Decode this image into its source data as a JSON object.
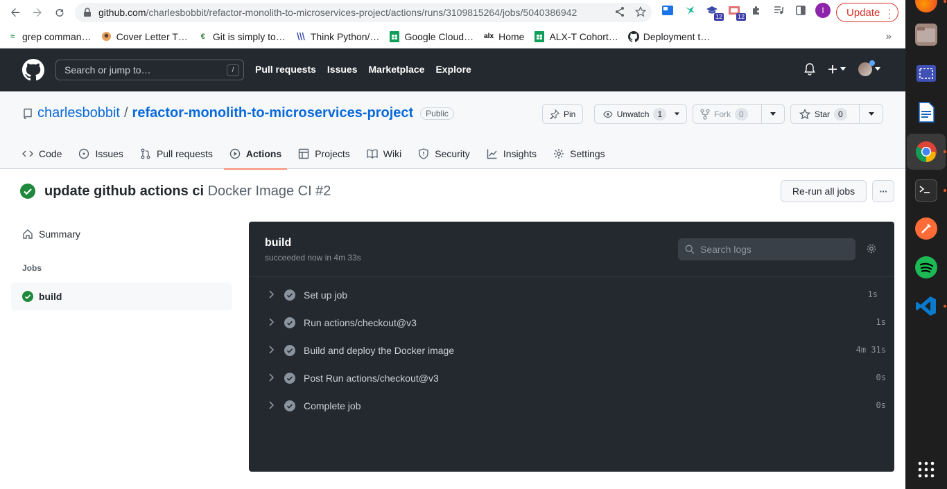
{
  "browser": {
    "url_domain": "github.com",
    "url_path": "/charlesbobbit/refactor-monolith-to-microservices-project/actions/runs/3109815264/jobs/5040386942",
    "update_label": "Update",
    "profile_initial": "I",
    "ext_badge": "12",
    "ext_badge2": "12",
    "bookmarks": [
      {
        "label": "grep comman…",
        "icon": "grep-icon"
      },
      {
        "label": "Cover Letter T…",
        "icon": "cover-letter-icon"
      },
      {
        "label": "Git is simply to…",
        "icon": "git-icon"
      },
      {
        "label": "Think Python/…",
        "icon": "python-icon"
      },
      {
        "label": "Google Cloud…",
        "icon": "sheets-icon"
      },
      {
        "label": "Home",
        "icon": "alx-icon"
      },
      {
        "label": "ALX-T Cohort…",
        "icon": "sheets-icon"
      },
      {
        "label": "Deployment t…",
        "icon": "github-icon"
      }
    ],
    "bookmarks_more": "»",
    "alx_text": "alx"
  },
  "github": {
    "search_placeholder": "Search or jump to…",
    "search_key": "/",
    "nav": [
      "Pull requests",
      "Issues",
      "Marketplace",
      "Explore"
    ]
  },
  "repo": {
    "owner": "charlesbobbit",
    "separator": "/",
    "name": "refactor-monolith-to-microservices-project",
    "visibility": "Public",
    "pin_label": "Pin",
    "watch_label": "Unwatch",
    "watch_count": "1",
    "fork_label": "Fork",
    "fork_count": "0",
    "star_label": "Star",
    "star_count": "0",
    "tabs": [
      "Code",
      "Issues",
      "Pull requests",
      "Actions",
      "Projects",
      "Wiki",
      "Security",
      "Insights",
      "Settings"
    ],
    "active_tab": "Actions"
  },
  "run": {
    "title": "update github actions ci",
    "workflow": "Docker Image CI #2",
    "rerun_label": "Re-run all jobs",
    "more_label": "···"
  },
  "sidebar": {
    "summary_label": "Summary",
    "jobs_heading": "Jobs",
    "job_name": "build"
  },
  "job": {
    "name": "build",
    "status": "succeeded now in 4m 33s",
    "search_placeholder": "Search logs",
    "steps": [
      {
        "label": "Set up job",
        "duration": "1s"
      },
      {
        "label": "Run actions/checkout@v3",
        "duration": "1s"
      },
      {
        "label": "Build and deploy the Docker image",
        "duration": "4m 31s"
      },
      {
        "label": "Post Run actions/checkout@v3",
        "duration": "0s"
      },
      {
        "label": "Complete job",
        "duration": "0s"
      }
    ]
  },
  "colors": {
    "success": "#1f883d",
    "github_header": "#24292f",
    "link": "#0969da",
    "active_tab_underline": "#fd8c73",
    "chrome_update": "#d93025"
  }
}
